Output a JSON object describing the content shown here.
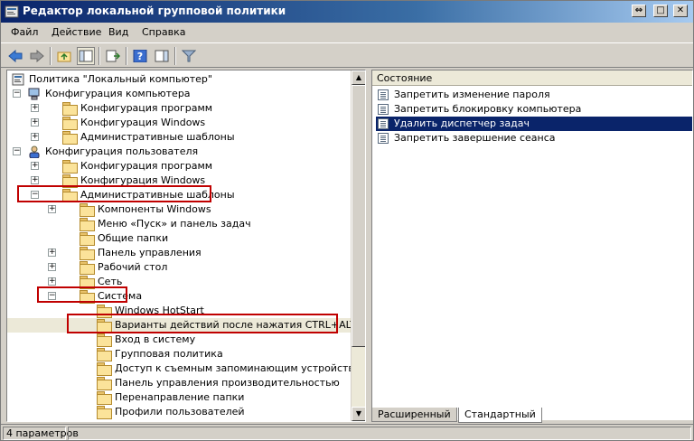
{
  "window": {
    "title": "Редактор локальной групповой политики"
  },
  "menu": [
    "Файл",
    "Действие",
    "Вид",
    "Справка"
  ],
  "tree": [
    {
      "label": "Политика \"Локальный компьютер\"",
      "level": 0,
      "expander": "none",
      "icon": "policy-icon"
    },
    {
      "label": "Конфигурация компьютера",
      "level": 1,
      "expander": "minus",
      "icon": "computer-icon"
    },
    {
      "label": "Конфигурация программ",
      "level": 2,
      "expander": "plus",
      "icon": "folder-icon"
    },
    {
      "label": "Конфигурация Windows",
      "level": 2,
      "expander": "plus",
      "icon": "folder-icon"
    },
    {
      "label": "Административные шаблоны",
      "level": 2,
      "expander": "plus",
      "icon": "folder-icon"
    },
    {
      "label": "Конфигурация пользователя",
      "level": 1,
      "expander": "minus",
      "icon": "user-icon"
    },
    {
      "label": "Конфигурация программ",
      "level": 2,
      "expander": "plus",
      "icon": "folder-icon"
    },
    {
      "label": "Конфигурация Windows",
      "level": 2,
      "expander": "plus",
      "icon": "folder-icon"
    },
    {
      "label": "Административные шаблоны",
      "level": 2,
      "expander": "minus",
      "icon": "folder-icon"
    },
    {
      "label": "Компоненты Windows",
      "level": 3,
      "expander": "plus",
      "icon": "folder-icon"
    },
    {
      "label": "Меню «Пуск» и панель задач",
      "level": 3,
      "expander": "none",
      "icon": "folder-icon"
    },
    {
      "label": "Общие папки",
      "level": 3,
      "expander": "none",
      "icon": "folder-icon"
    },
    {
      "label": "Панель управления",
      "level": 3,
      "expander": "plus",
      "icon": "folder-icon"
    },
    {
      "label": "Рабочий стол",
      "level": 3,
      "expander": "plus",
      "icon": "folder-icon"
    },
    {
      "label": "Сеть",
      "level": 3,
      "expander": "plus",
      "icon": "folder-icon"
    },
    {
      "label": "Система",
      "level": 3,
      "expander": "minus",
      "icon": "folder-icon"
    },
    {
      "label": "Windows HotStart",
      "level": 4,
      "expander": "none",
      "icon": "folder-icon"
    },
    {
      "label": "Варианты действий после нажатия CTRL+ALT+DEL",
      "level": 4,
      "expander": "none",
      "icon": "folder-icon",
      "selected": true
    },
    {
      "label": "Вход в систему",
      "level": 4,
      "expander": "none",
      "icon": "folder-icon"
    },
    {
      "label": "Групповая политика",
      "level": 4,
      "expander": "none",
      "icon": "folder-icon"
    },
    {
      "label": "Доступ к съемным запоминающим устройствам",
      "level": 4,
      "expander": "none",
      "icon": "folder-icon"
    },
    {
      "label": "Панель управления производительностью",
      "level": 4,
      "expander": "none",
      "icon": "folder-icon"
    },
    {
      "label": "Перенаправление папки",
      "level": 4,
      "expander": "none",
      "icon": "folder-icon"
    },
    {
      "label": "Профили пользователей",
      "level": 4,
      "expander": "none",
      "icon": "folder-icon"
    }
  ],
  "list": {
    "header": "Состояние",
    "items": [
      {
        "label": "Запретить изменение пароля",
        "selected": false
      },
      {
        "label": "Запретить блокировку компьютера",
        "selected": false
      },
      {
        "label": "Удалить диспетчер задач",
        "selected": true
      },
      {
        "label": "Запретить завершение сеанса",
        "selected": false
      }
    ]
  },
  "tabs": [
    "Расширенный",
    "Стандартный"
  ],
  "active_tab": "Стандартный",
  "status": "4 параметров"
}
